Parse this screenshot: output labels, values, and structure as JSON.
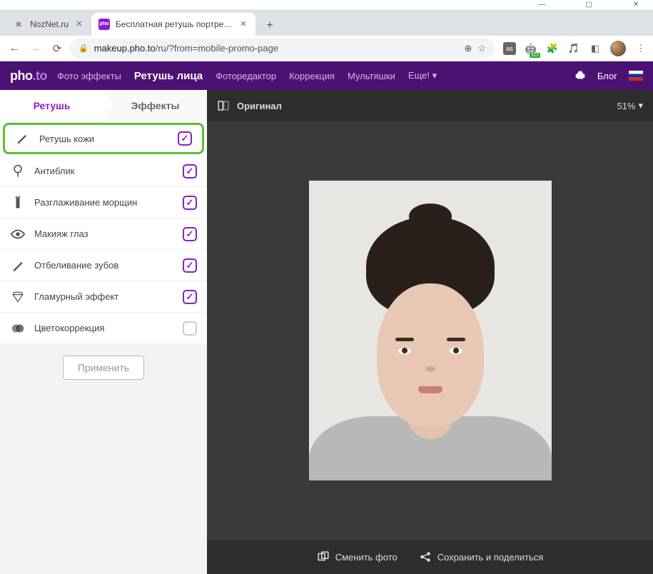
{
  "window": {
    "minimize": "—",
    "maximize": "▢",
    "close": "✕"
  },
  "tabs": {
    "items": [
      {
        "title": "NozNet.ru",
        "favicon": "✖"
      },
      {
        "title": "Бесплатная ретушь портретных",
        "favicon": "pho"
      }
    ],
    "new": "+"
  },
  "toolbar": {
    "url_host": "makeup.pho.to",
    "url_path": "/ru/?from=mobile-promo-page"
  },
  "site": {
    "logo_main": "pho",
    "logo_accent": ".to",
    "nav": [
      {
        "label": "Фото эффекты"
      },
      {
        "label": "Ретушь лица"
      },
      {
        "label": "Фоторедактор"
      },
      {
        "label": "Коррекция"
      },
      {
        "label": "Мультяшки"
      },
      {
        "label": "Еще! ▾"
      }
    ],
    "blog": "Блог"
  },
  "sidebar": {
    "tabs": {
      "retouch": "Ретушь",
      "effects": "Эффекты"
    },
    "options": [
      {
        "label": "Ретушь кожи",
        "checked": true,
        "hl": true
      },
      {
        "label": "Антиблик",
        "checked": true
      },
      {
        "label": "Разглаживание морщин",
        "checked": true
      },
      {
        "label": "Макияж глаз",
        "checked": true
      },
      {
        "label": "Отбеливание зубов",
        "checked": true
      },
      {
        "label": "Гламурный эффект",
        "checked": true
      },
      {
        "label": "Цветокоррекция",
        "checked": false
      }
    ],
    "apply": "Применить"
  },
  "editor": {
    "original": "Оригинал",
    "zoom": "51%",
    "change": "Сменить фото",
    "save": "Сохранить и поделиться"
  }
}
